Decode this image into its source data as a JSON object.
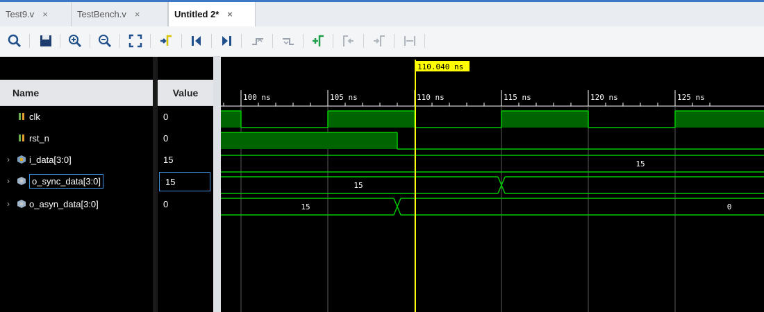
{
  "tabs": [
    {
      "label": "Test9.v",
      "close": "×"
    },
    {
      "label": "TestBench.v",
      "close": "×"
    },
    {
      "label": "Untitled 2*",
      "close": "×"
    }
  ],
  "toolbar": {
    "icons": [
      "search-icon",
      "save-icon",
      "zoom-in-icon",
      "zoom-out-icon",
      "zoom-fit-icon",
      "go-to-cursor-icon",
      "go-to-start-icon",
      "go-to-end-icon",
      "previous-transition-icon",
      "next-transition-icon",
      "add-marker-icon",
      "previous-marker-icon",
      "next-marker-icon",
      "swap-cursors-icon"
    ]
  },
  "columns": {
    "name": "Name",
    "value": "Value"
  },
  "signals": [
    {
      "name": "clk",
      "value": "0",
      "type": "bit"
    },
    {
      "name": "rst_n",
      "value": "0",
      "type": "bit"
    },
    {
      "name": "i_data[3:0]",
      "value": "15",
      "type": "bus"
    },
    {
      "name": "o_sync_data[3:0]",
      "value": "15",
      "type": "bus",
      "selected": true
    },
    {
      "name": "o_asyn_data[3:0]",
      "value": "0",
      "type": "bus"
    }
  ],
  "cursor": {
    "time_label": "110.040 ns",
    "time_ns": 110.04
  },
  "timeline": {
    "ticks": [
      "100 ns",
      "105 ns",
      "110 ns",
      "115 ns",
      "120 ns",
      "125 ns"
    ],
    "tick_values_ns": [
      100,
      105,
      110,
      115,
      120,
      125
    ]
  },
  "bus_labels": {
    "i_data": "15",
    "o_sync_before": "15",
    "o_asyn_before": "15",
    "o_asyn_after": "0"
  },
  "colors": {
    "wave": "#00c800",
    "wave_fill": "#006400",
    "cursor": "#ffff00",
    "grid": "#5a5a5a"
  }
}
